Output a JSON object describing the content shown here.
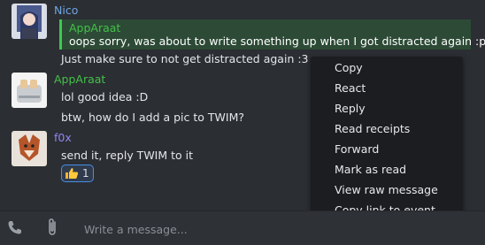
{
  "messages": [
    {
      "sender": "Nico",
      "avatar_icon": "anime-character-avatar",
      "quote": {
        "sender": "AppAraat",
        "text": "oops sorry, was about to write something up when I got distracted again :p"
      },
      "lines": [
        "Just make sure to not get distracted again :3"
      ]
    },
    {
      "sender": "AppAraat",
      "avatar_icon": "toaster-avatar",
      "lines": [
        "lol good idea :D",
        "btw, how do I add a pic to TWIM?"
      ]
    },
    {
      "sender": "f0x",
      "avatar_icon": "fox-avatar",
      "lines": [
        "send it, reply TWIM to it"
      ],
      "reaction": {
        "emoji": "thumbs-up-icon",
        "count": "1"
      }
    }
  ],
  "context_menu": {
    "items": [
      "Copy",
      "React",
      "Reply",
      "Read receipts",
      "Forward",
      "Mark as read",
      "View raw message",
      "Copy link to event"
    ]
  },
  "composer": {
    "placeholder": "Write a message...",
    "call_icon": "phone-icon",
    "attach_icon": "paperclip-icon"
  },
  "colors": {
    "background": "#2b2e33",
    "menu_background": "#1b1d21",
    "quote_border": "#3ccb4d",
    "reaction_border": "#4a8ee6"
  }
}
